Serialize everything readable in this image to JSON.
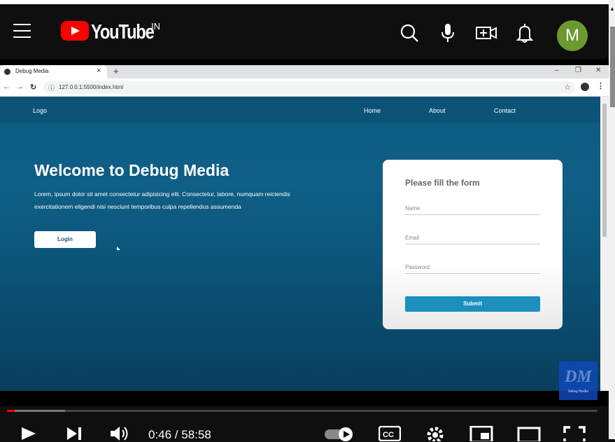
{
  "youtube": {
    "brand": "YouTube",
    "country": "IN",
    "avatar_letter": "M"
  },
  "browser": {
    "tab_title": "Debug Media",
    "url": "127.0.0.1:5500/index.html"
  },
  "site": {
    "logo": "Logo",
    "nav": [
      "Home",
      "About",
      "Contact"
    ],
    "heading": "Welcome to Debug Media",
    "paragraph": "Lorem, ipsum dolor sit amet consectetur adipisicing elit. Consectetur, labore, numquam reiciendis exercitationem eligendi nisi nesciunt temporibus culpa repellendus assumenda",
    "login_label": "Login",
    "form": {
      "title": "Please fill the form",
      "name_placeholder": "Name",
      "email_placeholder": "Email",
      "password_placeholder": "Password",
      "submit_label": "Submit"
    }
  },
  "watermark": {
    "letters": "DM",
    "caption": "Debug Media"
  },
  "player": {
    "time": "0:46 / 58:58",
    "played_fraction": 0.013,
    "buffered_fraction": 0.098
  }
}
